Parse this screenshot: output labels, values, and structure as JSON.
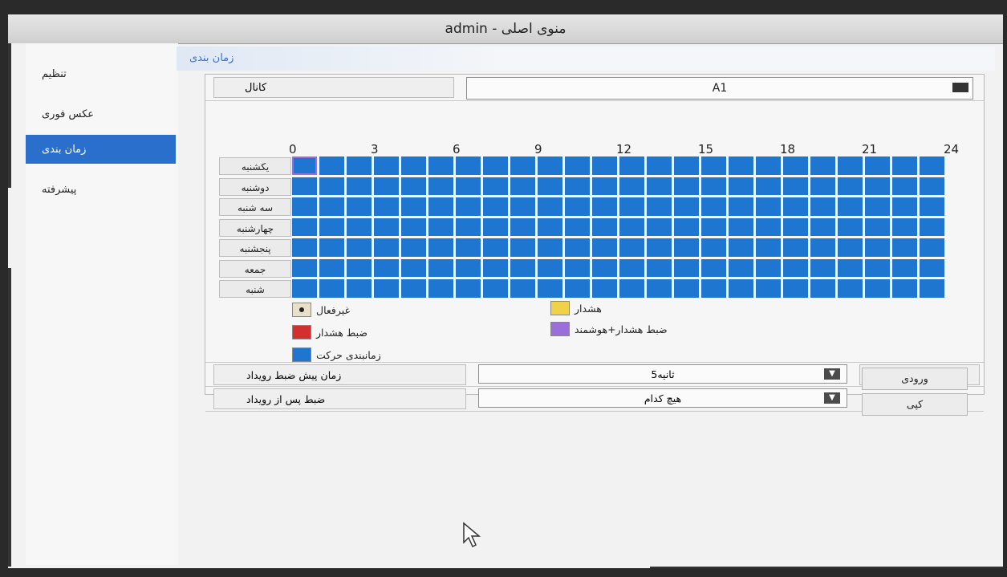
{
  "window": {
    "title": "admin - منوی اصلی"
  },
  "sidebar": {
    "items": [
      {
        "label": "تنظیم",
        "active": false
      },
      {
        "label": "عکس فوری",
        "active": false
      },
      {
        "label": "زمان بندی",
        "active": true
      },
      {
        "label": "پیشرفته",
        "active": false
      }
    ]
  },
  "section": {
    "title": "زمان بندی"
  },
  "channel": {
    "label": "کانال",
    "value": "A1"
  },
  "schedule": {
    "hours": [
      "0",
      "3",
      "6",
      "9",
      "12",
      "15",
      "18",
      "21",
      "24"
    ],
    "days": [
      "یکشنبه",
      "دوشنبه",
      "سه شنبه",
      "چهارشنبه",
      "پنجشنبه",
      "جمعه",
      "شنبه"
    ],
    "slots_per_day": 24,
    "fill_color": "#1f76d0",
    "selected_slot": {
      "day": 0,
      "hour": 0
    }
  },
  "legend": {
    "inactive": {
      "label": "غیرفعال",
      "color": "#e8e0c8"
    },
    "alarm": {
      "label": "هشدار",
      "color": "#f0d24a"
    },
    "alarm_record": {
      "label": "ضبط هشدار",
      "color": "#d32f2f"
    },
    "alarm_smart": {
      "label": "ضبط هشدار+هوشمند",
      "color": "#9b6fd8"
    },
    "motion": {
      "label": "زمانبندی حرکت",
      "color": "#1f76d0"
    }
  },
  "form": {
    "pre_record_label": "زمان پیش ضبط رویداد",
    "pre_record_value": "5ثانیه",
    "post_record_label": "ضبط پس از رویداد",
    "post_record_value": "هیچ کدام"
  },
  "buttons": {
    "input": "ورودی",
    "copy": "کپی"
  }
}
